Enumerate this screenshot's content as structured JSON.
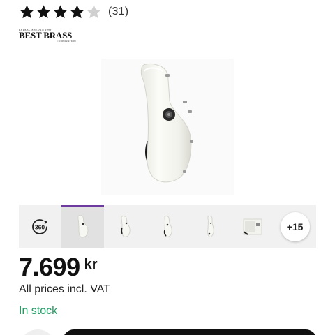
{
  "rating": {
    "stars_filled": 4,
    "stars_total": 5,
    "count": "(31)"
  },
  "brand": {
    "established": "ESTABLISHED IN 1999",
    "name": "BEST BRASS",
    "subtitle": "CORPORATION"
  },
  "gallery": {
    "rotate_label": "360",
    "more_label": "+15",
    "active_index": 1
  },
  "price": {
    "value": "7.699",
    "currency": "kr"
  },
  "vat_note": "All prices incl. VAT",
  "stock_status": "In stock",
  "colors": {
    "accent": "#6d3aa0",
    "in_stock": "#1f9d62",
    "star_filled": "#111111",
    "star_empty": "#d0d0d0"
  }
}
